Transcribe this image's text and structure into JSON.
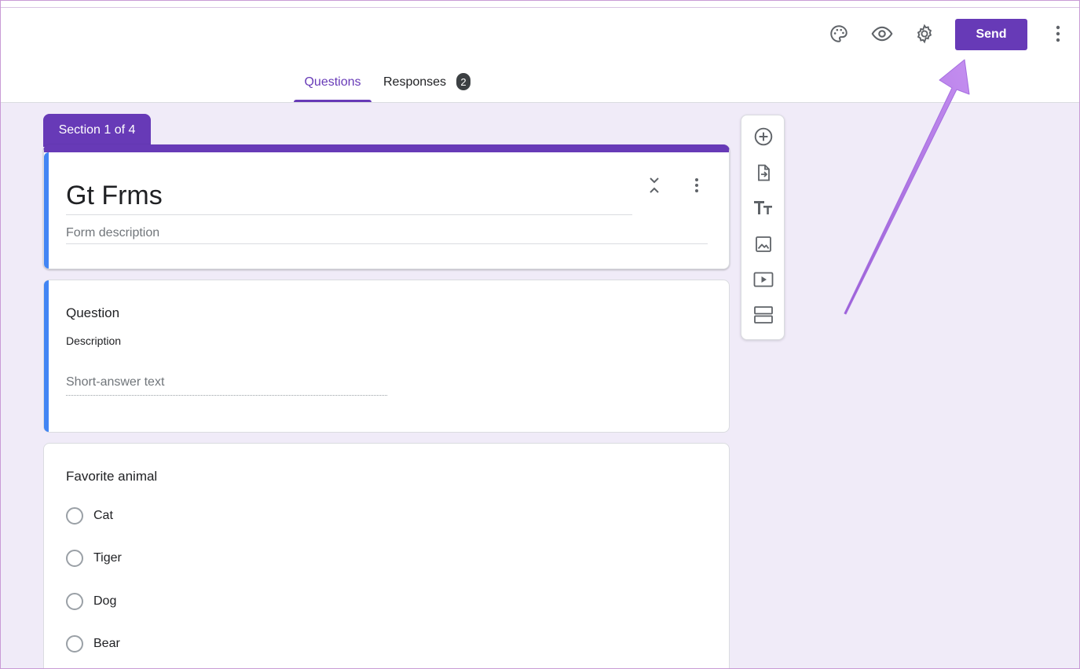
{
  "header": {
    "icons": [
      "palette-icon",
      "eye-icon",
      "gear-icon",
      "more-vertical-icon"
    ],
    "send_label": "Send"
  },
  "tabs": {
    "questions_label": "Questions",
    "responses_label": "Responses",
    "responses_count": "2"
  },
  "section": {
    "label": "Section 1 of 4"
  },
  "form": {
    "title": "Gt Frms",
    "description_placeholder": "Form description"
  },
  "question_1": {
    "title": "Question",
    "description": "Description",
    "answer_placeholder": "Short-answer text"
  },
  "question_2": {
    "title": "Favorite animal",
    "options": [
      "Cat",
      "Tiger",
      "Dog",
      "Bear"
    ]
  },
  "toolbar": {
    "icons": [
      "add-question-icon",
      "import-questions-icon",
      "add-title-icon",
      "add-image-icon",
      "add-video-icon",
      "add-section-icon"
    ]
  },
  "colors": {
    "accent": "#673ab7",
    "background": "#f0ebf8",
    "question_accent": "#4285f4",
    "annotation_arrow": "#b57ee6"
  }
}
